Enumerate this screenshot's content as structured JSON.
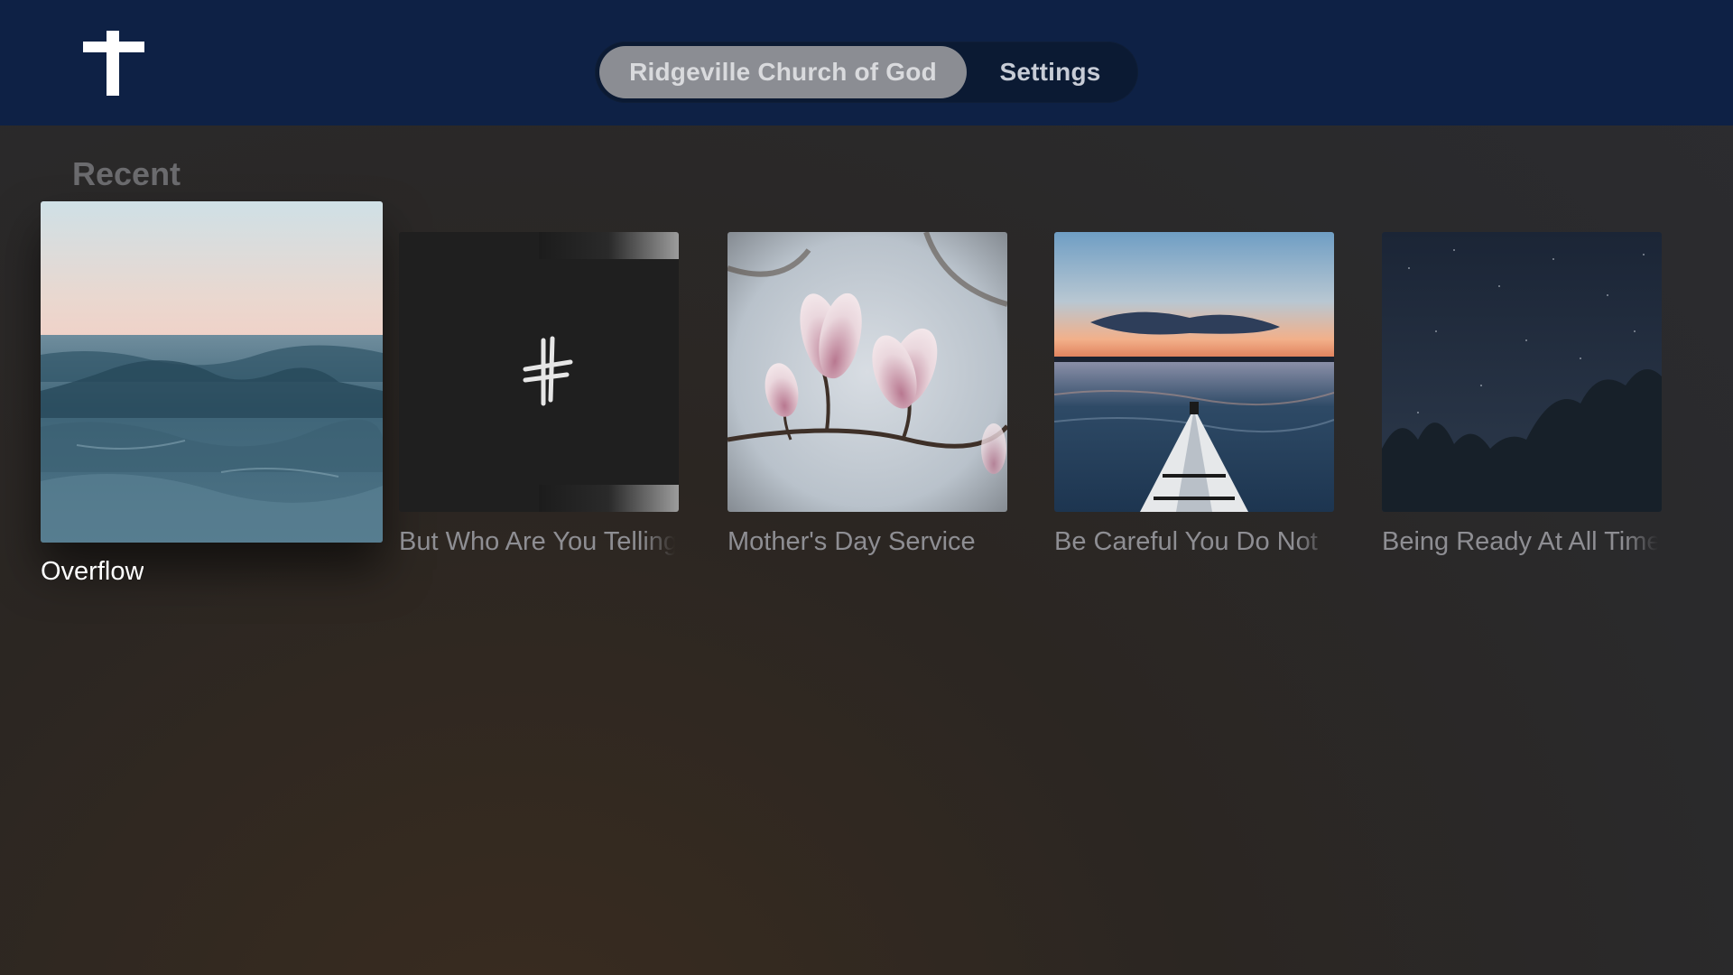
{
  "header": {
    "logo_icon": "cross-icon",
    "background_color": "#0e2145",
    "tabs": [
      {
        "label": "Ridgeville Church of God",
        "selected": true
      },
      {
        "label": "Settings",
        "selected": false
      }
    ]
  },
  "shelf": {
    "title": "Recent",
    "items": [
      {
        "title": "Overflow",
        "art": "ocean-waves-image",
        "focused": true
      },
      {
        "title": "But Who Are You Telling",
        "art": "cross-logo-image",
        "focused": false
      },
      {
        "title": "Mother's Day Service",
        "art": "magnolia-blossom-image",
        "focused": false
      },
      {
        "title": "Be Careful You Do Not",
        "art": "kayak-sunset-image",
        "focused": false
      },
      {
        "title": "Being Ready At All Times",
        "art": "starry-forest-image",
        "focused": false
      }
    ]
  }
}
